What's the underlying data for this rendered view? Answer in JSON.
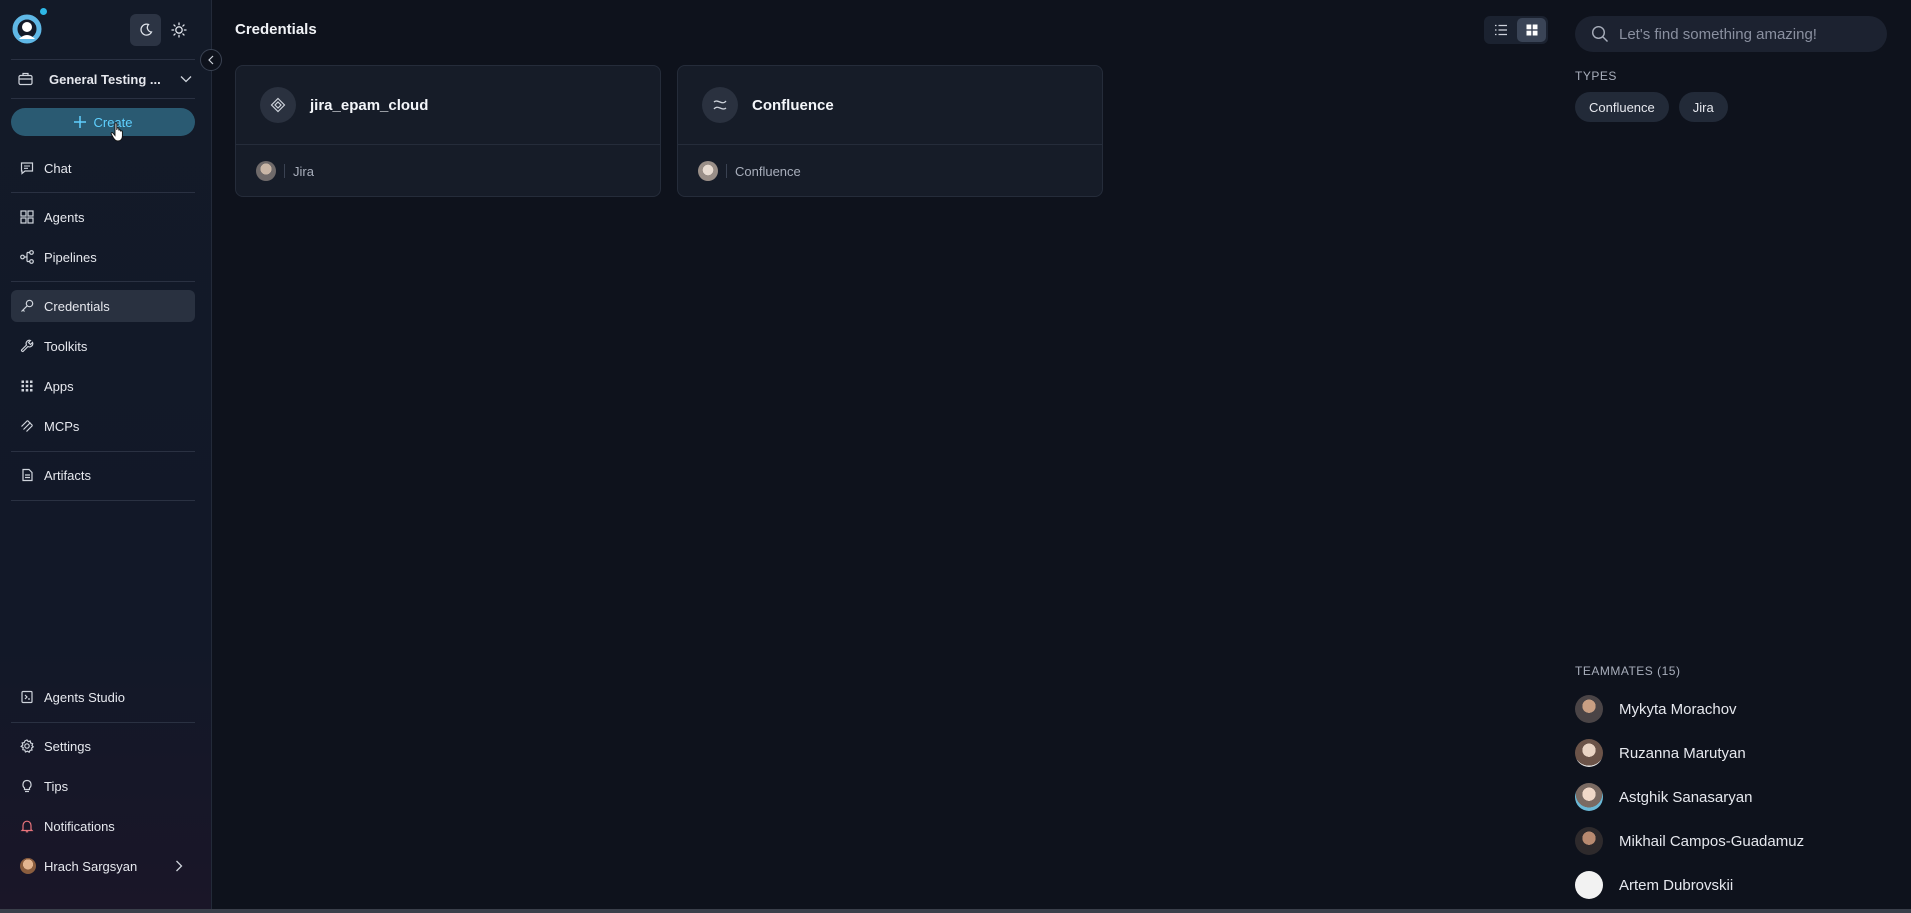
{
  "theme": {
    "accent": "#5fd0ff",
    "create_bg": "#2a5a72",
    "background": "#0e121c"
  },
  "project": {
    "name": "General Testing ..."
  },
  "create_label": "Create",
  "nav": {
    "chat": "Chat",
    "agents": "Agents",
    "pipelines": "Pipelines",
    "credentials": "Credentials",
    "toolkits": "Toolkits",
    "apps": "Apps",
    "mcps": "MCPs",
    "artifacts": "Artifacts",
    "agents_studio": "Agents Studio",
    "settings": "Settings",
    "tips": "Tips",
    "notifications": "Notifications",
    "user": "Hrach Sargsyan"
  },
  "active_nav": "credentials",
  "page_title": "Credentials",
  "view_mode": "grid",
  "cards": [
    {
      "title": "jira_epam_cloud",
      "type": "Jira",
      "icon": "jira-icon"
    },
    {
      "title": "Confluence",
      "type": "Confluence",
      "icon": "confluence-icon"
    }
  ],
  "search": {
    "placeholder": "Let's find something amazing!"
  },
  "types": {
    "label": "TYPES",
    "items": [
      "Confluence",
      "Jira"
    ]
  },
  "teammates": {
    "label": "TEAMMATES (15)",
    "items": [
      {
        "name": "Mykyta Morachov"
      },
      {
        "name": "Ruzanna Marutyan"
      },
      {
        "name": "Astghik Sanasaryan"
      },
      {
        "name": "Mikhail Campos-Guadamuz"
      },
      {
        "name": "Artem Dubrovskii"
      }
    ]
  }
}
